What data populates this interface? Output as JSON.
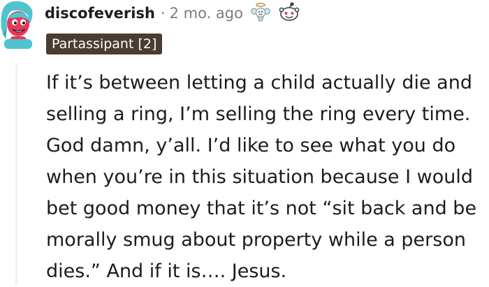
{
  "comment": {
    "username": "discofeverish",
    "separator": "·",
    "timestamp": "2 mo. ago",
    "flair": "Partassipant [2]",
    "body": "If it’s between letting a child actually die and selling a ring, I’m selling the ring every time. God damn, y’all. I’d like to see what you do when you’re in this situation because I would bet good money that it’s not “sit back and be morally smug about property while a person dies.” And if it is…. Jesus.",
    "awards": [
      "angel-wings-award-icon",
      "wholesome-face-award-icon"
    ],
    "colors": {
      "flair_background": "#4b3c32",
      "flair_text": "#ffffff",
      "meta_text": "#7c7c7c",
      "thread_line": "#edeff1",
      "avatar_hair": "#4fc4cf",
      "avatar_face": "#e8365d"
    }
  }
}
